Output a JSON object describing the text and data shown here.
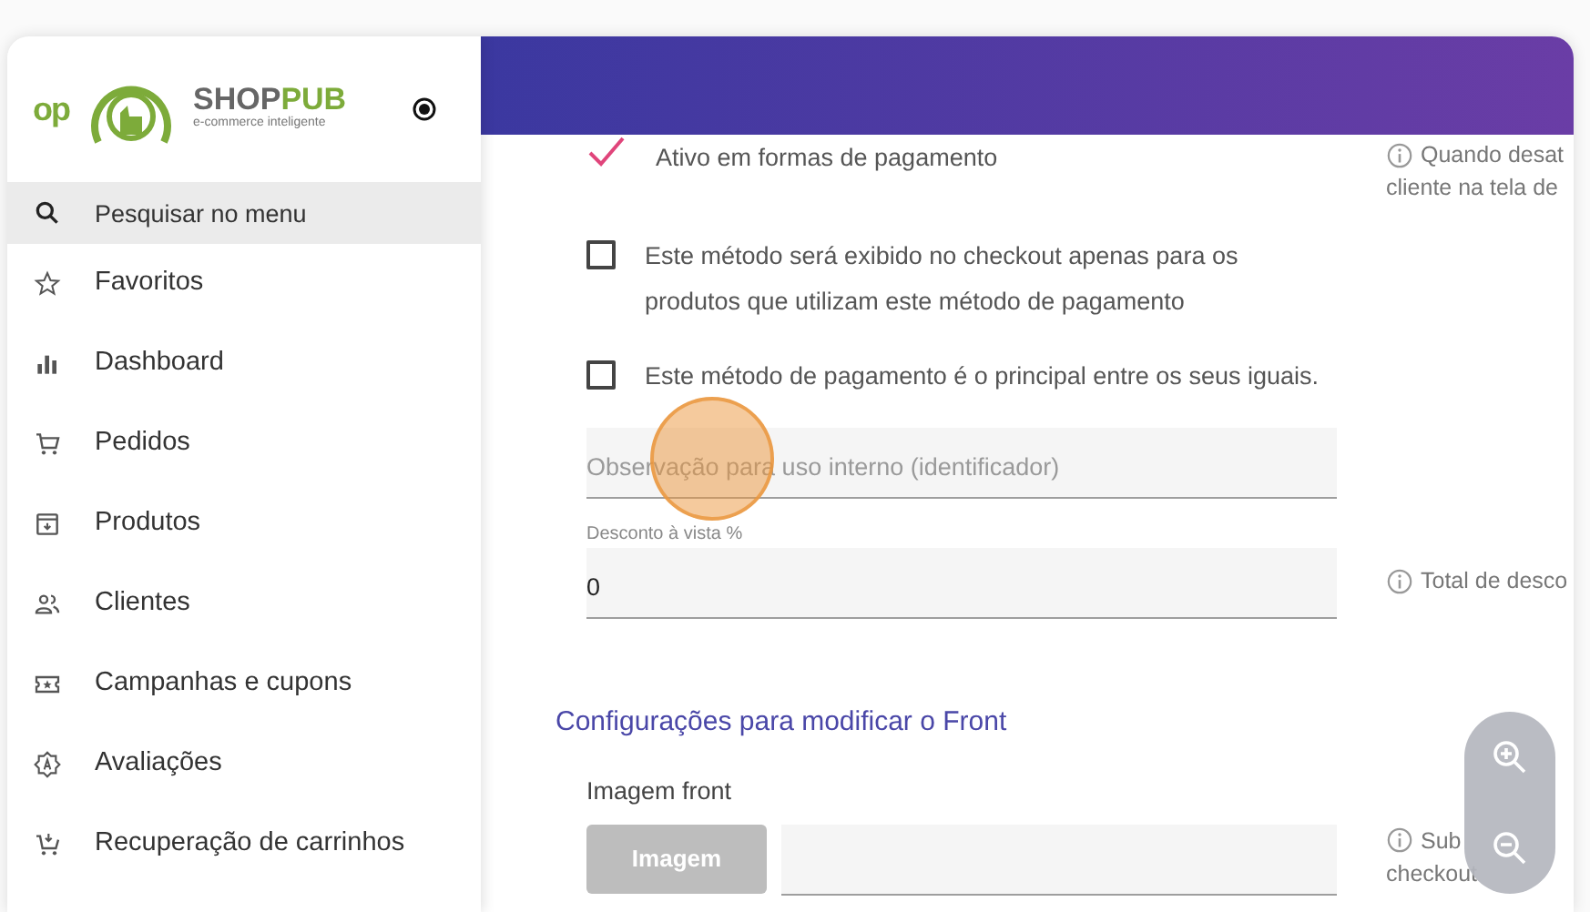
{
  "sidebar": {
    "logo": {
      "mark": "op",
      "brand_dark": "SHOP",
      "brand_green": "PUB",
      "tagline": "e-commerce inteligente"
    },
    "search": {
      "placeholder": "Pesquisar no menu"
    },
    "items": [
      {
        "label": "Favoritos"
      },
      {
        "label": "Dashboard"
      },
      {
        "label": "Pedidos"
      },
      {
        "label": "Produtos"
      },
      {
        "label": "Clientes"
      },
      {
        "label": "Campanhas e cupons"
      },
      {
        "label": "Avaliações"
      },
      {
        "label": "Recuperação de carrinhos"
      }
    ]
  },
  "form": {
    "rows": [
      {
        "kind": "check",
        "lines": [
          "Ativo em formas de pagamento"
        ],
        "checked": true,
        "help": [
          "Quando desat",
          "cliente na tela de"
        ]
      },
      {
        "kind": "check",
        "lines": [
          "Este método será exibido no checkout apenas para os",
          "produtos que utilizam este método de pagamento"
        ],
        "checked": false
      },
      {
        "kind": "check",
        "lines": [
          "Este método de pagamento é o principal entre os seus iguais."
        ],
        "checked": false
      },
      {
        "kind": "field",
        "placeholder": "Observação para uso interno (identificador)"
      },
      {
        "kind": "field",
        "label": "Desconto à vista %",
        "value": "0",
        "help": [
          "Total de desco"
        ]
      },
      {
        "kind": "section",
        "title": "Configurações para modificar o Front"
      },
      {
        "kind": "upload",
        "label": "Imagem front",
        "button": "Imagem",
        "help": [
          "Sub",
          "checkout"
        ]
      }
    ]
  }
}
